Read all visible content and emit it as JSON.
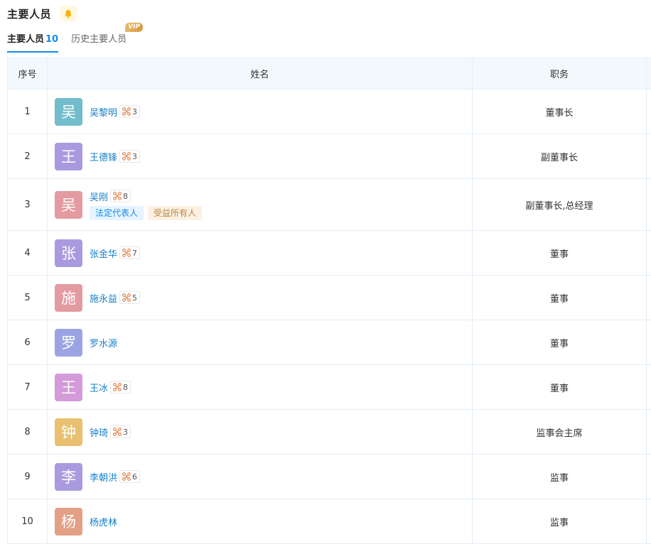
{
  "header": {
    "title": "主要人员",
    "bell_icon": "bell-icon"
  },
  "tabs": [
    {
      "label": "主要人员",
      "count": "10"
    },
    {
      "label": "历史主要人员",
      "badge": "VIP"
    }
  ],
  "table": {
    "columns": [
      "序号",
      "姓名",
      "职务"
    ],
    "rows": [
      {
        "index": "1",
        "avatar_char": "吴",
        "avatar_color": "#72bccb",
        "name": "吴黎明",
        "relations": "3",
        "position": "董事长",
        "tags": []
      },
      {
        "index": "2",
        "avatar_char": "王",
        "avatar_color": "#a99ae0",
        "name": "王德锋",
        "relations": "3",
        "position": "副董事长",
        "tags": []
      },
      {
        "index": "3",
        "avatar_char": "吴",
        "avatar_color": "#e39aa0",
        "name": "吴刚",
        "relations": "8",
        "position": "副董事长,总经理",
        "tags": [
          {
            "text": "法定代表人",
            "style": "blue"
          },
          {
            "text": "受益所有人",
            "style": "orange"
          }
        ]
      },
      {
        "index": "4",
        "avatar_char": "张",
        "avatar_color": "#a99ae0",
        "name": "张金华",
        "relations": "7",
        "position": "董事",
        "tags": []
      },
      {
        "index": "5",
        "avatar_char": "施",
        "avatar_color": "#e39aa0",
        "name": "施永益",
        "relations": "5",
        "position": "董事",
        "tags": []
      },
      {
        "index": "6",
        "avatar_char": "罗",
        "avatar_color": "#9aa4e3",
        "name": "罗水源",
        "relations": "",
        "position": "董事",
        "tags": []
      },
      {
        "index": "7",
        "avatar_char": "王",
        "avatar_color": "#d49ad9",
        "name": "王冰",
        "relations": "8",
        "position": "董事",
        "tags": []
      },
      {
        "index": "8",
        "avatar_char": "钟",
        "avatar_color": "#e8c070",
        "name": "钟琦",
        "relations": "3",
        "position": "监事会主席",
        "tags": []
      },
      {
        "index": "9",
        "avatar_char": "李",
        "avatar_color": "#a99ae0",
        "name": "李朝洪",
        "relations": "6",
        "position": "监事",
        "tags": []
      },
      {
        "index": "10",
        "avatar_char": "杨",
        "avatar_color": "#e3a085",
        "name": "杨虎林",
        "relations": "",
        "position": "监事",
        "tags": []
      }
    ]
  }
}
